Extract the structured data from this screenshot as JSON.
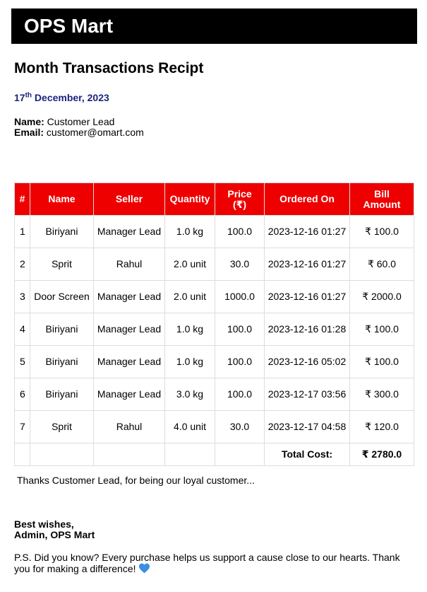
{
  "header": {
    "brand": "OPS Mart"
  },
  "title": "Month Transactions Recipt",
  "date": {
    "day": "17",
    "suffix": "th",
    "rest": " December, 2023"
  },
  "customer": {
    "name_label": "Name:",
    "name": " Customer Lead",
    "email_label": "Email:",
    "email": " customer@omart.com"
  },
  "table": {
    "headers": [
      "#",
      "Name",
      "Seller",
      "Quantity",
      "Price\n(₹)",
      "Ordered On",
      "Bill\nAmount"
    ],
    "rows": [
      [
        "1",
        "Biriyani",
        "Manager Lead",
        "1.0 kg",
        "100.0",
        "2023-12-16 01:27",
        "₹ 100.0"
      ],
      [
        "2",
        "Sprit",
        "Rahul",
        "2.0 unit",
        "30.0",
        "2023-12-16 01:27",
        "₹ 60.0"
      ],
      [
        "3",
        "Door Screen",
        "Manager Lead",
        "2.0 unit",
        "1000.0",
        "2023-12-16 01:27",
        "₹ 2000.0"
      ],
      [
        "4",
        "Biriyani",
        "Manager Lead",
        "1.0 kg",
        "100.0",
        "2023-12-16 01:28",
        "₹ 100.0"
      ],
      [
        "5",
        "Biriyani",
        "Manager Lead",
        "1.0 kg",
        "100.0",
        "2023-12-16 05:02",
        "₹ 100.0"
      ],
      [
        "6",
        "Biriyani",
        "Manager Lead",
        "3.0 kg",
        "100.0",
        "2023-12-17 03:56",
        "₹ 300.0"
      ],
      [
        "7",
        "Sprit",
        "Rahul",
        "4.0 unit",
        "30.0",
        "2023-12-17 04:58",
        "₹ 120.0"
      ]
    ],
    "total_label": "Total Cost:",
    "total_value": "₹ 2780.0"
  },
  "thanks": "Thanks Customer Lead, for being our loyal customer...",
  "closing": {
    "line1": "Best wishes,",
    "line2": "Admin, OPS Mart"
  },
  "ps": "P.S. Did you know? Every purchase helps us support a cause close to our hearts. Thank you for making a difference!",
  "heart_icon": "blue-heart-icon",
  "colors": {
    "banner": "#000000",
    "header_bg": "#ee0000",
    "date": "#1a237e",
    "heart": "#3b8fe0"
  }
}
